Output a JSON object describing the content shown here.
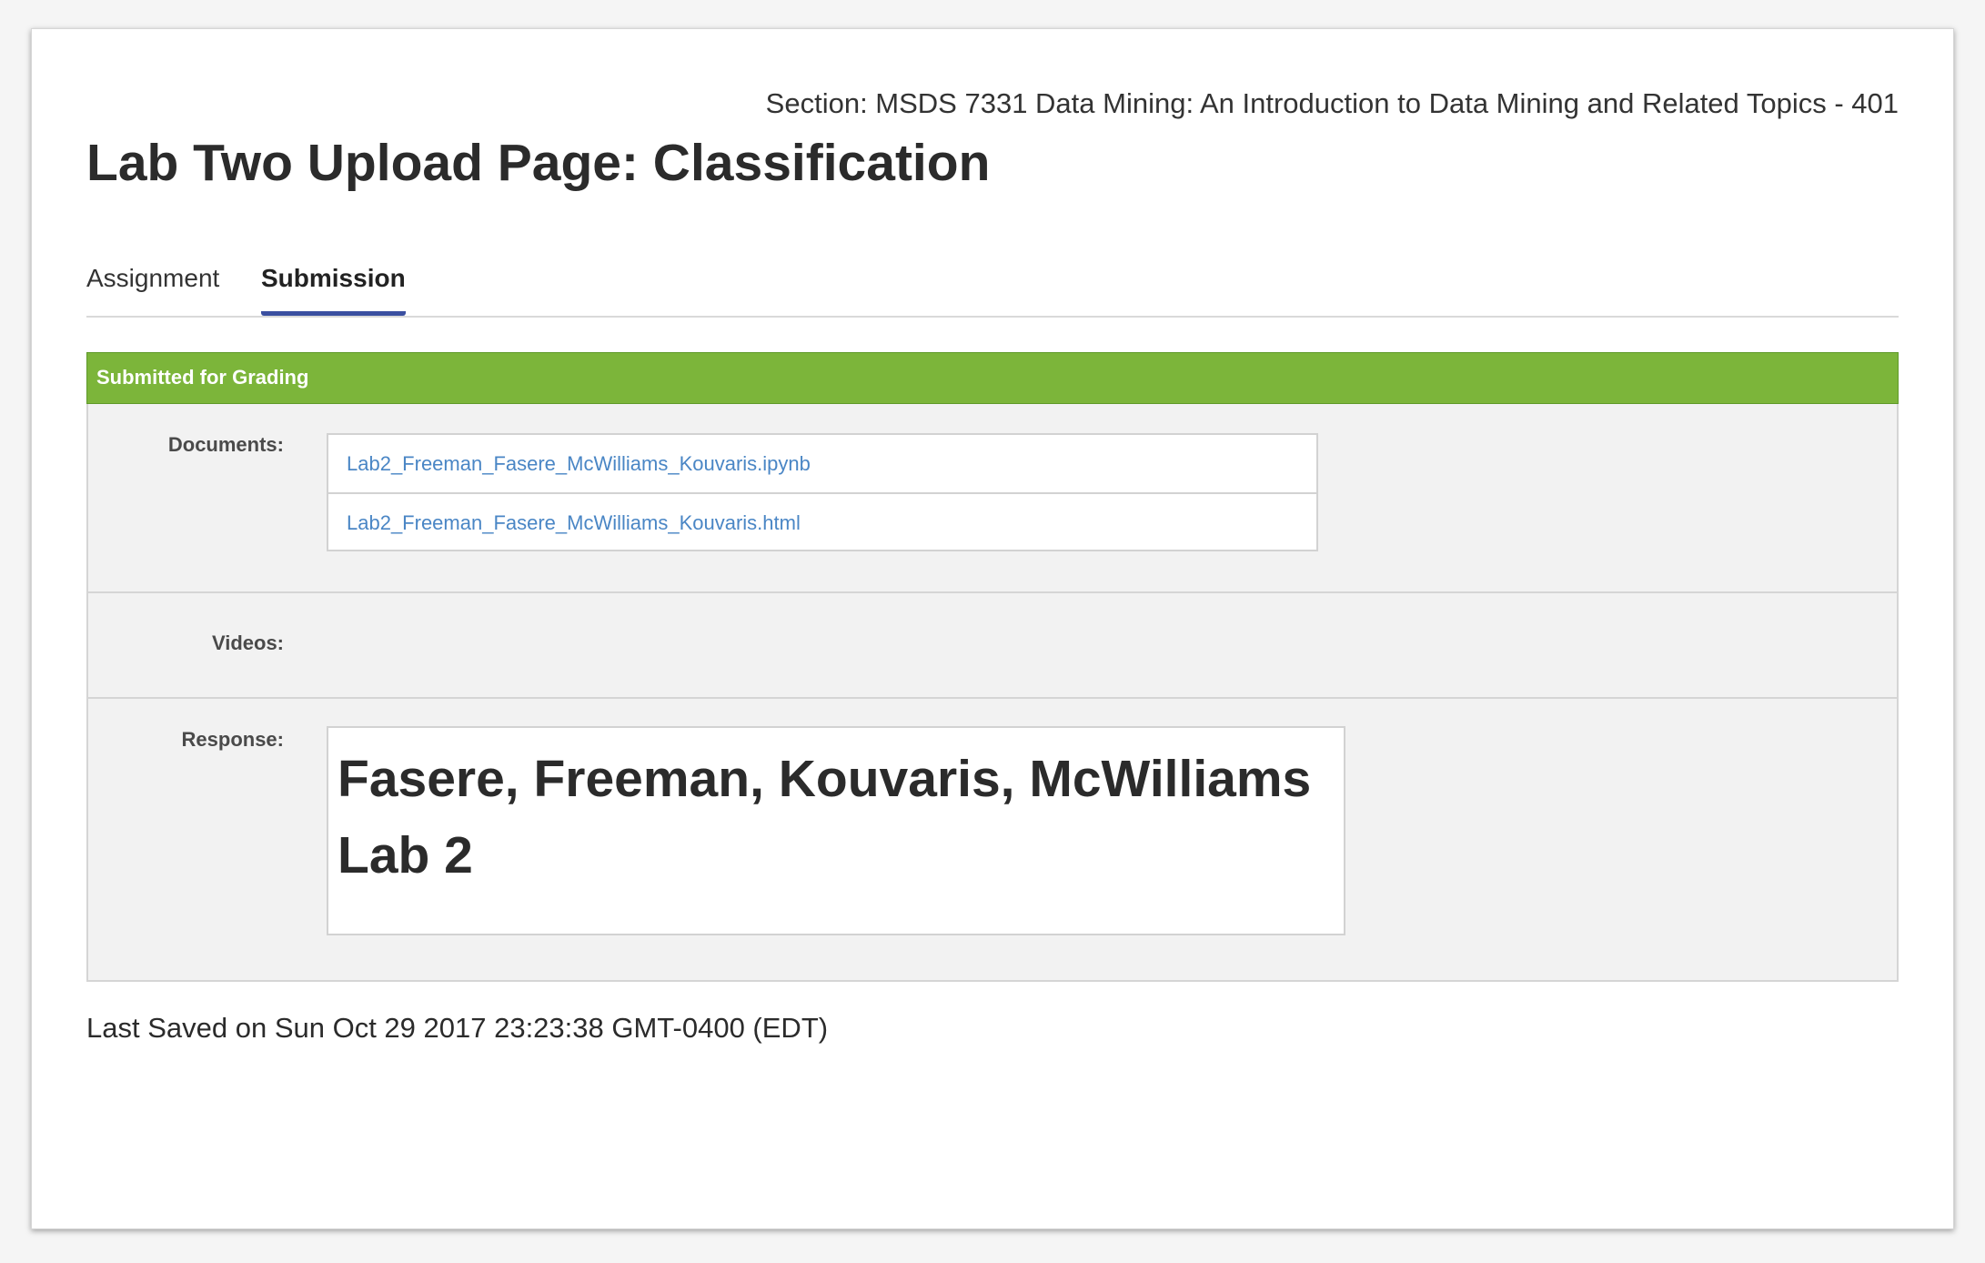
{
  "header": {
    "section": "Section: MSDS 7331 Data Mining: An Introduction to Data Mining and Related Topics - 401",
    "title": "Lab Two Upload Page: Classification"
  },
  "tabs": [
    {
      "label": "Assignment",
      "active": false
    },
    {
      "label": "Submission",
      "active": true
    }
  ],
  "submission": {
    "status": "Submitted for Grading",
    "status_color": "#7cb53a",
    "documents_label": "Documents:",
    "documents": [
      "Lab2_Freeman_Fasere_McWilliams_Kouvaris.ipynb",
      "Lab2_Freeman_Fasere_McWilliams_Kouvaris.html"
    ],
    "videos_label": "Videos:",
    "response_label": "Response:",
    "response_text": "Fasere, Freeman, Kouvaris, McWilliams Lab 2"
  },
  "footer": {
    "last_saved": "Last Saved on Sun Oct 29 2017 23:23:38 GMT-0400 (EDT)"
  },
  "colors": {
    "link": "#4a86c5",
    "active_tab_underline": "#3a4fa0",
    "panel_background": "#f2f2f2"
  }
}
